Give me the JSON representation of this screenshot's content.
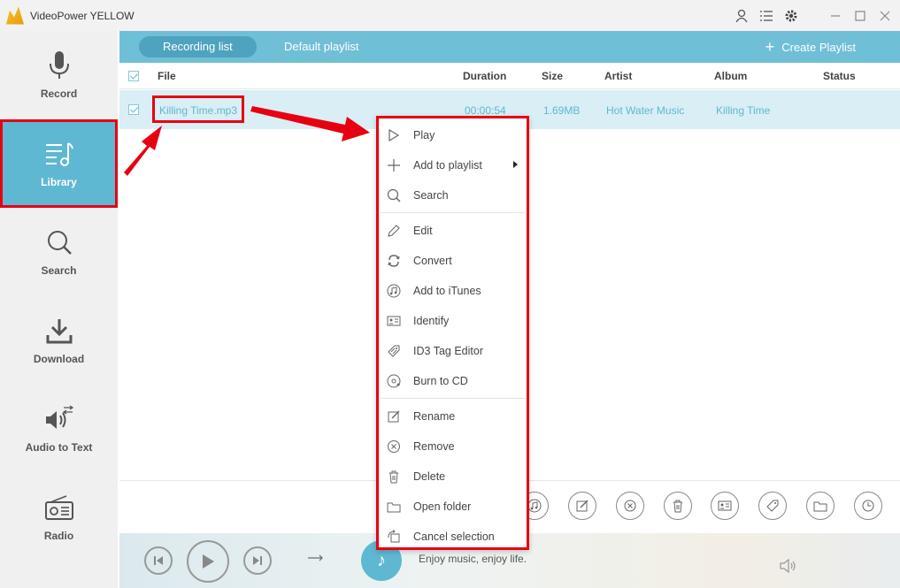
{
  "app": {
    "title": "VideoPower YELLOW"
  },
  "titlebar_icons": [
    "user-icon",
    "menu-list-icon",
    "gear-icon",
    "minimize-icon",
    "maximize-icon",
    "close-icon"
  ],
  "sidebar": {
    "items": [
      {
        "label": "Record",
        "icon": "microphone-icon"
      },
      {
        "label": "Library",
        "icon": "library-music-icon",
        "active": true
      },
      {
        "label": "Search",
        "icon": "search-icon"
      },
      {
        "label": "Download",
        "icon": "download-icon"
      },
      {
        "label": "Audio to Text",
        "icon": "audio-to-text-icon"
      },
      {
        "label": "Radio",
        "icon": "radio-icon"
      }
    ]
  },
  "tabs": [
    {
      "label": "Recording list",
      "active": true
    },
    {
      "label": "Default playlist",
      "active": false
    }
  ],
  "create_playlist": {
    "label": "Create Playlist"
  },
  "table": {
    "columns": [
      "File",
      "Duration",
      "Size",
      "Artist",
      "Album",
      "Status"
    ],
    "rows": [
      {
        "file": "Killing Time.mp3",
        "duration": "00:00:54",
        "size": "1.69MB",
        "artist": "Hot Water Music",
        "album": "Killing Time",
        "status": ""
      }
    ]
  },
  "context_menu": {
    "items": [
      {
        "label": "Play",
        "icon": "play-icon"
      },
      {
        "label": "Add to playlist",
        "icon": "plus-icon",
        "submenu": true
      },
      {
        "label": "Search",
        "icon": "search-icon"
      },
      {
        "label": "Edit",
        "icon": "pencil-icon"
      },
      {
        "label": "Convert",
        "icon": "convert-icon"
      },
      {
        "label": "Add to iTunes",
        "icon": "itunes-icon"
      },
      {
        "label": "Identify",
        "icon": "id-card-icon"
      },
      {
        "label": "ID3 Tag Editor",
        "icon": "tag-icon"
      },
      {
        "label": "Burn to CD",
        "icon": "cd-icon"
      },
      {
        "label": "Rename",
        "icon": "rename-icon"
      },
      {
        "label": "Remove",
        "icon": "remove-icon"
      },
      {
        "label": "Delete",
        "icon": "trash-icon"
      },
      {
        "label": "Open folder",
        "icon": "folder-icon"
      },
      {
        "label": "Cancel selection",
        "icon": "cancel-selection-icon"
      }
    ]
  },
  "bottom_toolbar_icons": [
    "itunes-icon",
    "edit-icon",
    "remove-icon",
    "trash-icon",
    "id-card-icon",
    "tag-icon",
    "folder-icon",
    "clock-icon"
  ],
  "player": {
    "tagline": "Enjoy music, enjoy life."
  },
  "colors": {
    "accent": "#5fb8d2",
    "tabbar": "#6fbfd6",
    "highlight": "#e60012"
  }
}
